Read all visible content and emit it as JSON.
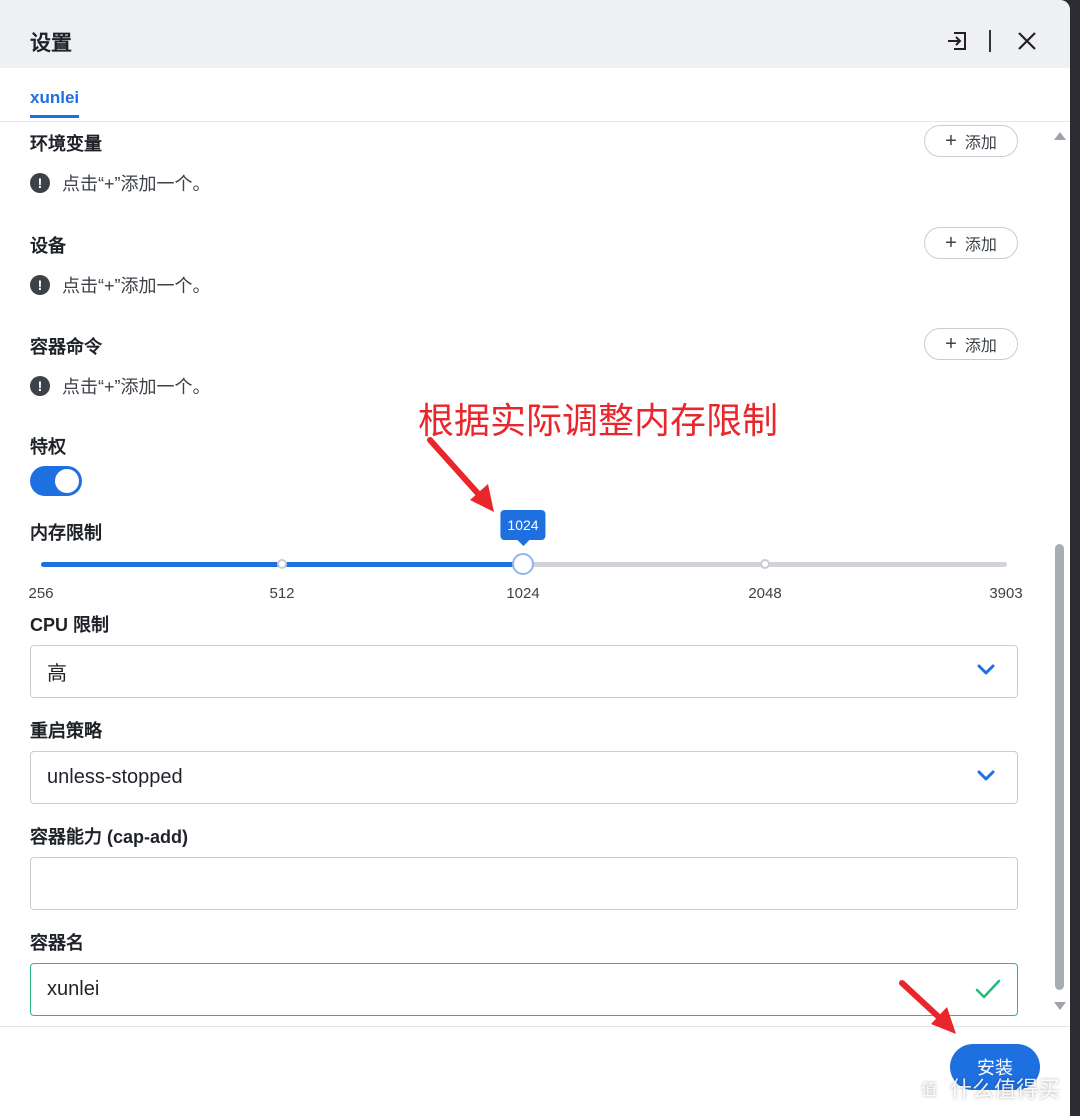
{
  "window": {
    "title": "设置",
    "tab": "xunlei"
  },
  "sections": {
    "env": {
      "label": "环境变量",
      "hint": "点击“+”添加一个。",
      "add_label": "添加"
    },
    "devices": {
      "label": "设备",
      "hint": "点击“+”添加一个。",
      "add_label": "添加"
    },
    "command": {
      "label": "容器命令",
      "hint": "点击“+”添加一个。",
      "add_label": "添加"
    },
    "privileged": {
      "label": "特权",
      "enabled": true
    },
    "memory": {
      "label": "内存限制",
      "value": "1024",
      "ticks": [
        "256",
        "512",
        "1024",
        "2048",
        "3903"
      ]
    },
    "cpu": {
      "label": "CPU 限制",
      "value": "高"
    },
    "restart": {
      "label": "重启策略",
      "value": "unless-stopped"
    },
    "cap_add": {
      "label": "容器能力 (cap-add)",
      "value": ""
    },
    "name": {
      "label": "容器名",
      "value": "xunlei"
    }
  },
  "footer": {
    "install_label": "安装"
  },
  "annotation": {
    "text": "根据实际调整内存限制"
  },
  "watermark": {
    "text": "什么值得买",
    "logo": "值"
  },
  "colors": {
    "accent": "#1e6fe0",
    "valid": "#2db87d",
    "annotation": "#e8262b"
  }
}
